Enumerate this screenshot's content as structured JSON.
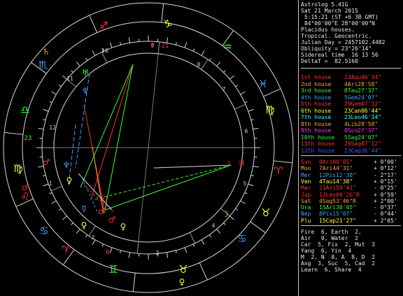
{
  "app": {
    "name": "Astrolog 5.41G",
    "date_line": "Sat 21 March 2015",
    "time_line": " 5:15:21 (ST +6 3B GMT)",
    "location_line": " 84°00'00\"E 28°00'00\"N",
    "house_system": "Placidus houses.",
    "zodiac": "Tropical. Geocentric.",
    "julian_day": "Julian Day = 2457102.4482",
    "obliquity": "Obliquity = 23°26'14\"",
    "sidereal_time": "Sidereal time  16 13 56",
    "delta_t": "DeltaT =  82.5160"
  },
  "houses": [
    {
      "label": "1st house",
      "value": "23Aqu46'34\"",
      "color": "#ff3030"
    },
    {
      "label": "2nd house",
      "value": "4Ari28'58\"",
      "color": "#ffa030"
    },
    {
      "label": "3rd house",
      "value": "8Tau27'37\"",
      "color": "#30ff30"
    },
    {
      "label": "4th house",
      "value": "5Gem24'07\"",
      "color": "#40a0ff"
    },
    {
      "label": "5th house",
      "value": "29Gem07'12\"",
      "color": "#ff3030"
    },
    {
      "label": "6th house",
      "value": "23Can06'44\"",
      "color": "#ffff30"
    },
    {
      "label": "7th house",
      "value": "23Leo46'34\"",
      "color": "#30ffff"
    },
    {
      "label": "8th house",
      "value": "4Lib28'58\"",
      "color": "#ffa030"
    },
    {
      "label": "9th house",
      "value": "8Sco27'37\"",
      "color": "#ff30ff"
    },
    {
      "label": "10th house",
      "value": "5Sag24'07\"",
      "color": "#30ff30"
    },
    {
      "label": "11th house",
      "value": "29Sag07'12\"",
      "color": "#ff3030"
    },
    {
      "label": "12th house",
      "value": "23Cap36'44\"",
      "color": "#5050ff"
    }
  ],
  "planets": [
    {
      "name": "Sun",
      "pos": "0Ari00'01\"",
      "lat": "+ 0°00'",
      "color": "#ff3030"
    },
    {
      "name": "Moo",
      "pos": "7Ari44'31\"",
      "lat": "+ 0°12'",
      "color": "#ffa030"
    },
    {
      "name": "Mer",
      "pos": "12Pis12'38\"",
      "lat": "- 2°17'",
      "color": "#40a0ff"
    },
    {
      "name": "Ven",
      "pos": "4Tau14'38\"",
      "lat": "+ 0°15'",
      "color": "#ffff30"
    },
    {
      "name": "Mar",
      "pos": "21Ari59'41\"",
      "lat": "- 0°25'",
      "color": "#ff3030"
    },
    {
      "name": "Jup",
      "pos": "13Leo09'26\"R",
      "lat": "+ 0°59'",
      "color": "#ff3030"
    },
    {
      "name": "Sat",
      "pos": "4Sag53'46\"R",
      "lat": "+ 2°00'",
      "color": "#ffa030"
    },
    {
      "name": "Ura",
      "pos": "15Ari30'45\"",
      "lat": "- 0°37'",
      "color": "#30ff30"
    },
    {
      "name": "Nep",
      "pos": "8Pis15'07\"",
      "lat": "- 0°44'",
      "color": "#40a0ff"
    },
    {
      "name": "Plu",
      "pos": "15Cap21'27\"",
      "lat": "+ 2°05'",
      "color": "#ffff30"
    }
  ],
  "summary": {
    "line1": "Fire  6, Earth  2,",
    "line2": "Air   0, Water  2",
    "line3": "Car  5, Fix  2, Mut  3",
    "line4": "Yang  6, Yin  4",
    "line5": "M  2, N  8, A  8, D  2",
    "line6": "Ang  3, Suc  5, Cad  2",
    "line7": "Learn  6, Share  4"
  },
  "chart_labels": {
    "house_numbers": [
      "1",
      "2",
      "3",
      "4",
      "5",
      "6",
      "7",
      "8",
      "9",
      "10",
      "11",
      "12"
    ],
    "cusp_degrees": {
      "top": "5",
      "top_right": "21",
      "right": "1",
      "left": "23",
      "bottom": "6"
    }
  },
  "colors": {
    "background": "#000000",
    "ring": "#d8d8d8",
    "fire": "#ff3030",
    "earth": "#ffff30",
    "air": "#30ff30",
    "water": "#40a0ff",
    "text": "#e8e8e8"
  }
}
